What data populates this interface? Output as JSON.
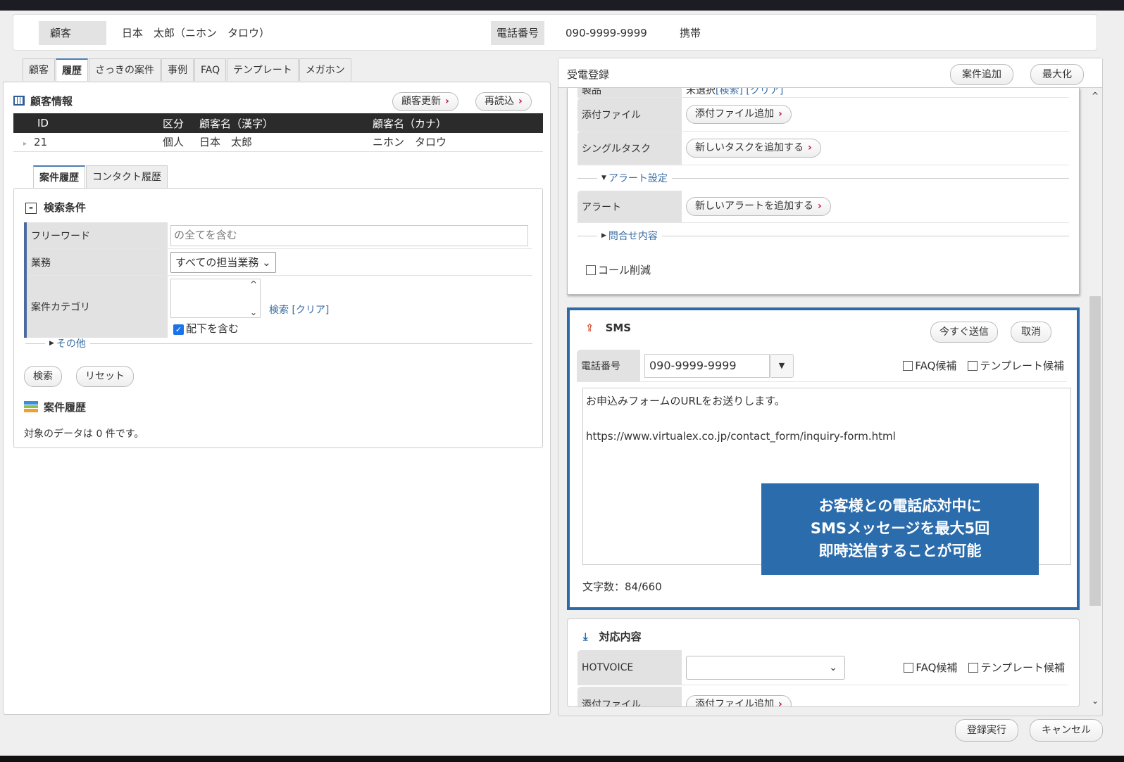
{
  "header": {
    "customer_label": "顧客",
    "customer_value": "日本　太郎（ニホン　タロウ）",
    "phone_label": "電話番号",
    "phone_value": "090-9999-9999",
    "phone_type": "携帯"
  },
  "left": {
    "tabs": [
      "顧客",
      "履歴",
      "さっきの案件",
      "事例",
      "FAQ",
      "テンプレート",
      "メガホン"
    ],
    "customer_info": {
      "title": "顧客情報",
      "update_btn": "顧客更新",
      "reload_btn": "再読込",
      "columns": [
        "ID",
        "区分",
        "顧客名（漢字）",
        "顧客名（カナ）"
      ],
      "rows": [
        [
          "21",
          "個人",
          "日本　太郎",
          "ニホン　タロウ"
        ]
      ]
    },
    "subtabs": [
      "案件履歴",
      "コンタクト履歴"
    ],
    "search": {
      "title": "検索条件",
      "freeword_label": "フリーワード",
      "freeword_placeholder": "の全てを含む",
      "business_label": "業務",
      "business_value": "すべての担当業務",
      "category_label": "案件カテゴリ",
      "search_link": "検索",
      "clear_link": "[クリア]",
      "include_sub": "配下を含む",
      "other": "その他",
      "search_btn": "検索",
      "reset_btn": "リセット"
    },
    "history": {
      "title": "案件履歴",
      "empty": "対象のデータは 0 件です。"
    }
  },
  "right": {
    "title": "受電登録",
    "add_case_btn": "案件追加",
    "maximize_btn": "最大化",
    "product_label": "製品",
    "product_value": "未選択",
    "product_search": "[検索]",
    "product_clear": "[クリア]",
    "attach_label": "添付ファイル",
    "attach_btn": "添付ファイル追加",
    "task_label": "シングルタスク",
    "task_btn": "新しいタスクを追加する",
    "alert_section": "アラート設定",
    "alert_label": "アラート",
    "alert_btn": "新しいアラートを追加する",
    "inquiry_section": "問合せ内容",
    "call_reduce": "コール削減",
    "sms": {
      "title": "SMS",
      "send_btn": "今すぐ送信",
      "cancel_btn": "取消",
      "phone_label": "電話番号",
      "phone_value": "090-9999-9999",
      "faq_cb": "FAQ候補",
      "tpl_cb": "テンプレート候補",
      "message_line1": "お申込みフォームのURLをお送りします。",
      "message_line2": "https://www.virtualex.co.jp/contact_form/inquiry-form.html",
      "char_count": "文字数：84/660",
      "callout": [
        "お客様との電話応対中に",
        "SMSメッセージを最大5回",
        "即時送信することが可能"
      ]
    },
    "response": {
      "title": "対応内容",
      "hotvoice_label": "HOTVOICE",
      "faq_cb": "FAQ候補",
      "tpl_cb": "テンプレート候補",
      "attach_label": "添付ファイル",
      "attach_btn": "添付ファイル追加"
    }
  },
  "footer": {
    "submit_btn": "登録実行",
    "cancel_btn": "キャンセル"
  },
  "colors": {
    "accent": "#2e6aa8",
    "callout_bg": "#2b6cad",
    "link": "#3a6ea5"
  }
}
